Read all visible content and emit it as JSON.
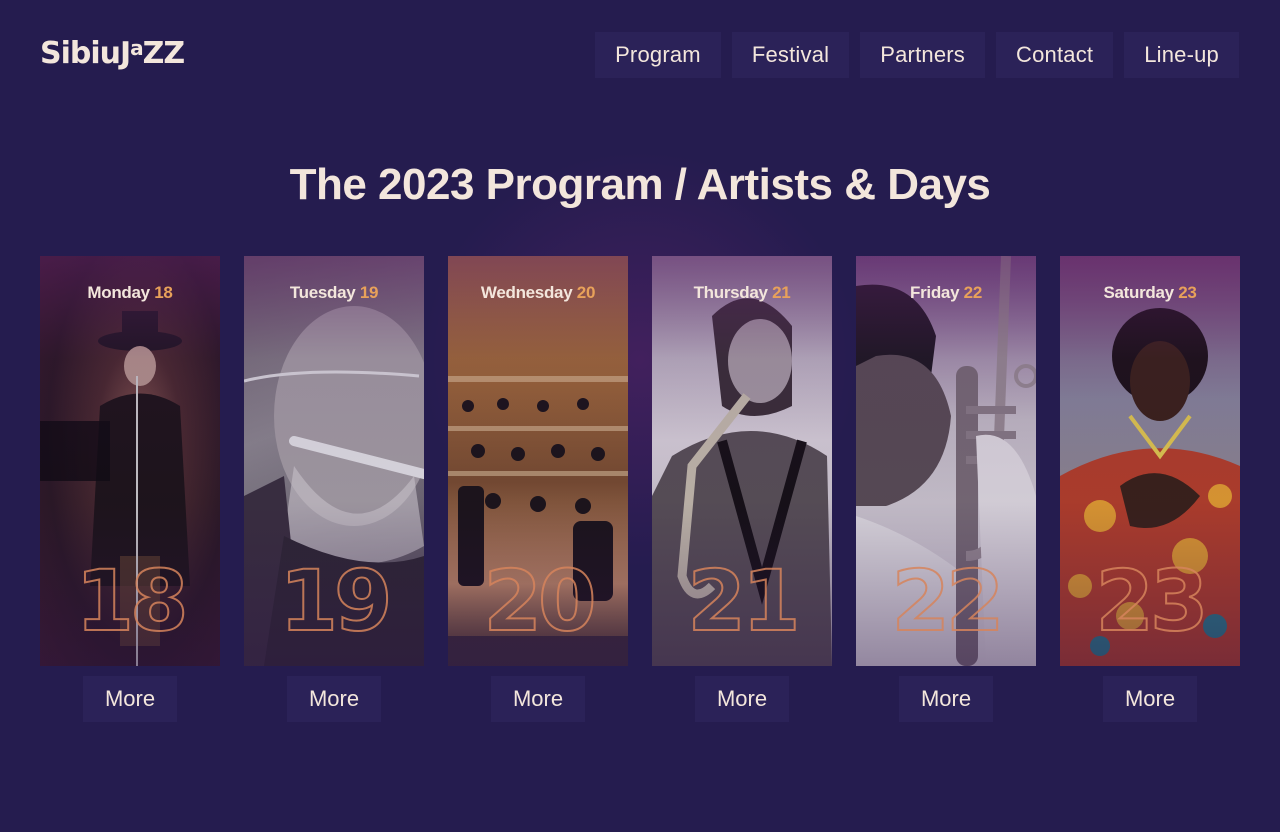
{
  "brand": {
    "logo_main": "SibiuJ",
    "logo_sup": "a",
    "logo_end": "ZZ"
  },
  "nav": [
    {
      "label": "Program"
    },
    {
      "label": "Festival"
    },
    {
      "label": "Partners"
    },
    {
      "label": "Contact"
    },
    {
      "label": "Line-up"
    }
  ],
  "heading": "The 2023 Program / Artists & Days",
  "days": [
    {
      "weekday": "Monday",
      "date": "18",
      "more": "More"
    },
    {
      "weekday": "Tuesday",
      "date": "19",
      "more": "More"
    },
    {
      "weekday": "Wednesday",
      "date": "20",
      "more": "More"
    },
    {
      "weekday": "Thursday",
      "date": "21",
      "more": "More"
    },
    {
      "weekday": "Friday",
      "date": "22",
      "more": "More"
    },
    {
      "weekday": "Saturday",
      "date": "23",
      "more": "More"
    }
  ],
  "colors": {
    "background": "#251c4f",
    "button": "#2b2258",
    "text": "#f3e6dc",
    "accent": "#e8a15a"
  }
}
